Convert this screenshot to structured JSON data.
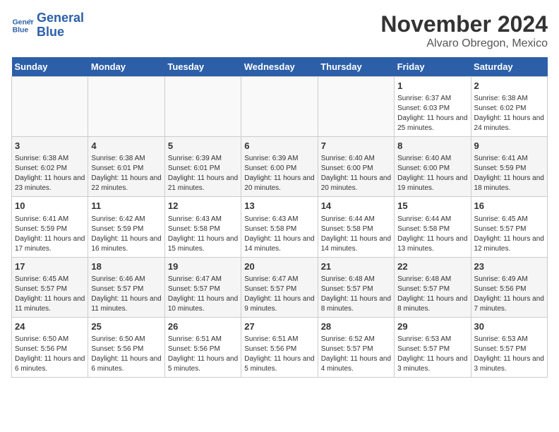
{
  "logo": {
    "text_general": "General",
    "text_blue": "Blue"
  },
  "title": "November 2024",
  "subtitle": "Alvaro Obregon, Mexico",
  "days_of_week": [
    "Sunday",
    "Monday",
    "Tuesday",
    "Wednesday",
    "Thursday",
    "Friday",
    "Saturday"
  ],
  "weeks": [
    [
      {
        "day": "",
        "info": ""
      },
      {
        "day": "",
        "info": ""
      },
      {
        "day": "",
        "info": ""
      },
      {
        "day": "",
        "info": ""
      },
      {
        "day": "",
        "info": ""
      },
      {
        "day": "1",
        "info": "Sunrise: 6:37 AM\nSunset: 6:03 PM\nDaylight: 11 hours and 25 minutes."
      },
      {
        "day": "2",
        "info": "Sunrise: 6:38 AM\nSunset: 6:02 PM\nDaylight: 11 hours and 24 minutes."
      }
    ],
    [
      {
        "day": "3",
        "info": "Sunrise: 6:38 AM\nSunset: 6:02 PM\nDaylight: 11 hours and 23 minutes."
      },
      {
        "day": "4",
        "info": "Sunrise: 6:38 AM\nSunset: 6:01 PM\nDaylight: 11 hours and 22 minutes."
      },
      {
        "day": "5",
        "info": "Sunrise: 6:39 AM\nSunset: 6:01 PM\nDaylight: 11 hours and 21 minutes."
      },
      {
        "day": "6",
        "info": "Sunrise: 6:39 AM\nSunset: 6:00 PM\nDaylight: 11 hours and 20 minutes."
      },
      {
        "day": "7",
        "info": "Sunrise: 6:40 AM\nSunset: 6:00 PM\nDaylight: 11 hours and 20 minutes."
      },
      {
        "day": "8",
        "info": "Sunrise: 6:40 AM\nSunset: 6:00 PM\nDaylight: 11 hours and 19 minutes."
      },
      {
        "day": "9",
        "info": "Sunrise: 6:41 AM\nSunset: 5:59 PM\nDaylight: 11 hours and 18 minutes."
      }
    ],
    [
      {
        "day": "10",
        "info": "Sunrise: 6:41 AM\nSunset: 5:59 PM\nDaylight: 11 hours and 17 minutes."
      },
      {
        "day": "11",
        "info": "Sunrise: 6:42 AM\nSunset: 5:59 PM\nDaylight: 11 hours and 16 minutes."
      },
      {
        "day": "12",
        "info": "Sunrise: 6:43 AM\nSunset: 5:58 PM\nDaylight: 11 hours and 15 minutes."
      },
      {
        "day": "13",
        "info": "Sunrise: 6:43 AM\nSunset: 5:58 PM\nDaylight: 11 hours and 14 minutes."
      },
      {
        "day": "14",
        "info": "Sunrise: 6:44 AM\nSunset: 5:58 PM\nDaylight: 11 hours and 14 minutes."
      },
      {
        "day": "15",
        "info": "Sunrise: 6:44 AM\nSunset: 5:58 PM\nDaylight: 11 hours and 13 minutes."
      },
      {
        "day": "16",
        "info": "Sunrise: 6:45 AM\nSunset: 5:57 PM\nDaylight: 11 hours and 12 minutes."
      }
    ],
    [
      {
        "day": "17",
        "info": "Sunrise: 6:45 AM\nSunset: 5:57 PM\nDaylight: 11 hours and 11 minutes."
      },
      {
        "day": "18",
        "info": "Sunrise: 6:46 AM\nSunset: 5:57 PM\nDaylight: 11 hours and 11 minutes."
      },
      {
        "day": "19",
        "info": "Sunrise: 6:47 AM\nSunset: 5:57 PM\nDaylight: 11 hours and 10 minutes."
      },
      {
        "day": "20",
        "info": "Sunrise: 6:47 AM\nSunset: 5:57 PM\nDaylight: 11 hours and 9 minutes."
      },
      {
        "day": "21",
        "info": "Sunrise: 6:48 AM\nSunset: 5:57 PM\nDaylight: 11 hours and 8 minutes."
      },
      {
        "day": "22",
        "info": "Sunrise: 6:48 AM\nSunset: 5:57 PM\nDaylight: 11 hours and 8 minutes."
      },
      {
        "day": "23",
        "info": "Sunrise: 6:49 AM\nSunset: 5:56 PM\nDaylight: 11 hours and 7 minutes."
      }
    ],
    [
      {
        "day": "24",
        "info": "Sunrise: 6:50 AM\nSunset: 5:56 PM\nDaylight: 11 hours and 6 minutes."
      },
      {
        "day": "25",
        "info": "Sunrise: 6:50 AM\nSunset: 5:56 PM\nDaylight: 11 hours and 6 minutes."
      },
      {
        "day": "26",
        "info": "Sunrise: 6:51 AM\nSunset: 5:56 PM\nDaylight: 11 hours and 5 minutes."
      },
      {
        "day": "27",
        "info": "Sunrise: 6:51 AM\nSunset: 5:56 PM\nDaylight: 11 hours and 5 minutes."
      },
      {
        "day": "28",
        "info": "Sunrise: 6:52 AM\nSunset: 5:57 PM\nDaylight: 11 hours and 4 minutes."
      },
      {
        "day": "29",
        "info": "Sunrise: 6:53 AM\nSunset: 5:57 PM\nDaylight: 11 hours and 3 minutes."
      },
      {
        "day": "30",
        "info": "Sunrise: 6:53 AM\nSunset: 5:57 PM\nDaylight: 11 hours and 3 minutes."
      }
    ]
  ]
}
